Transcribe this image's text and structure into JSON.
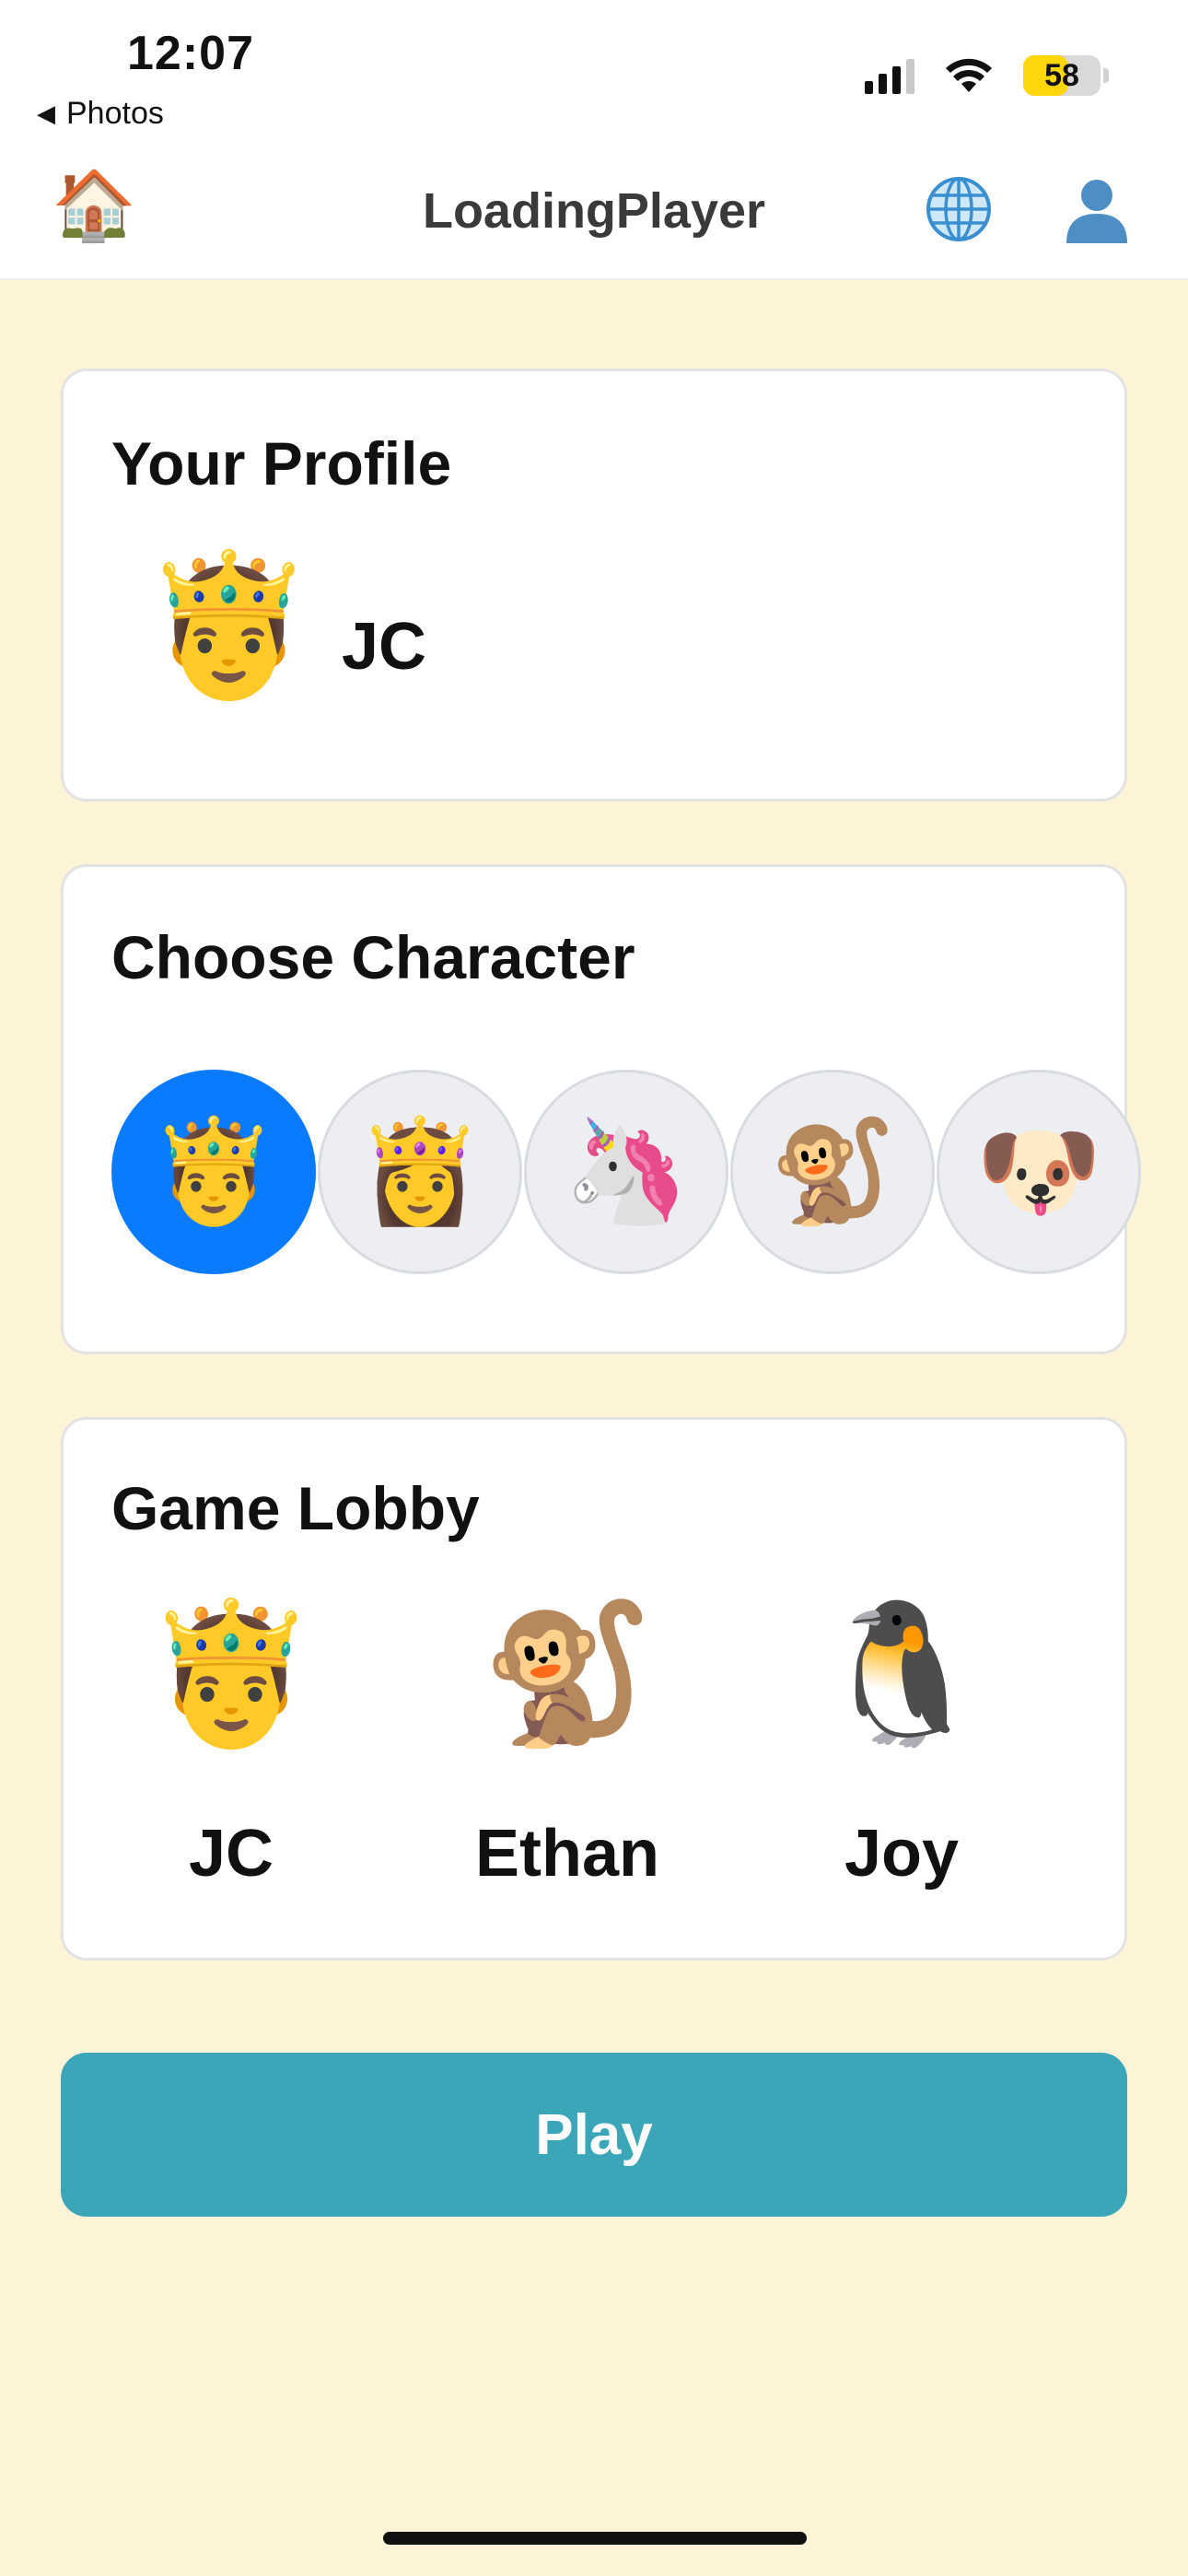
{
  "status_bar": {
    "time": "12:07",
    "back_label": "Photos",
    "battery_percent": 58,
    "battery_text": "58",
    "battery_color": "#ffd60a"
  },
  "nav": {
    "title": "LoadingPlayer",
    "home_icon": "🏠",
    "globe_icon": "globe-icon",
    "user_icon": "user-silhouette-icon"
  },
  "profile": {
    "title": "Your Profile",
    "avatar": "🤴",
    "name": "JC"
  },
  "character": {
    "title": "Choose Character",
    "options": [
      {
        "emoji": "🤴",
        "selected": true
      },
      {
        "emoji": "👸",
        "selected": false
      },
      {
        "emoji": "🦄",
        "selected": false
      },
      {
        "emoji": "🐒",
        "selected": false
      },
      {
        "emoji": "🐶",
        "selected": false
      }
    ],
    "selected_color": "#0a7bff"
  },
  "lobby": {
    "title": "Game Lobby",
    "players": [
      {
        "emoji": "🤴",
        "name": "JC"
      },
      {
        "emoji": "🐒",
        "name": "Ethan"
      },
      {
        "emoji": "🐧",
        "name": "Joy"
      }
    ]
  },
  "play_button": {
    "label": "Play",
    "color": "#3ba6b8"
  },
  "colors": {
    "background": "#fdf4d7",
    "card": "#ffffff"
  }
}
